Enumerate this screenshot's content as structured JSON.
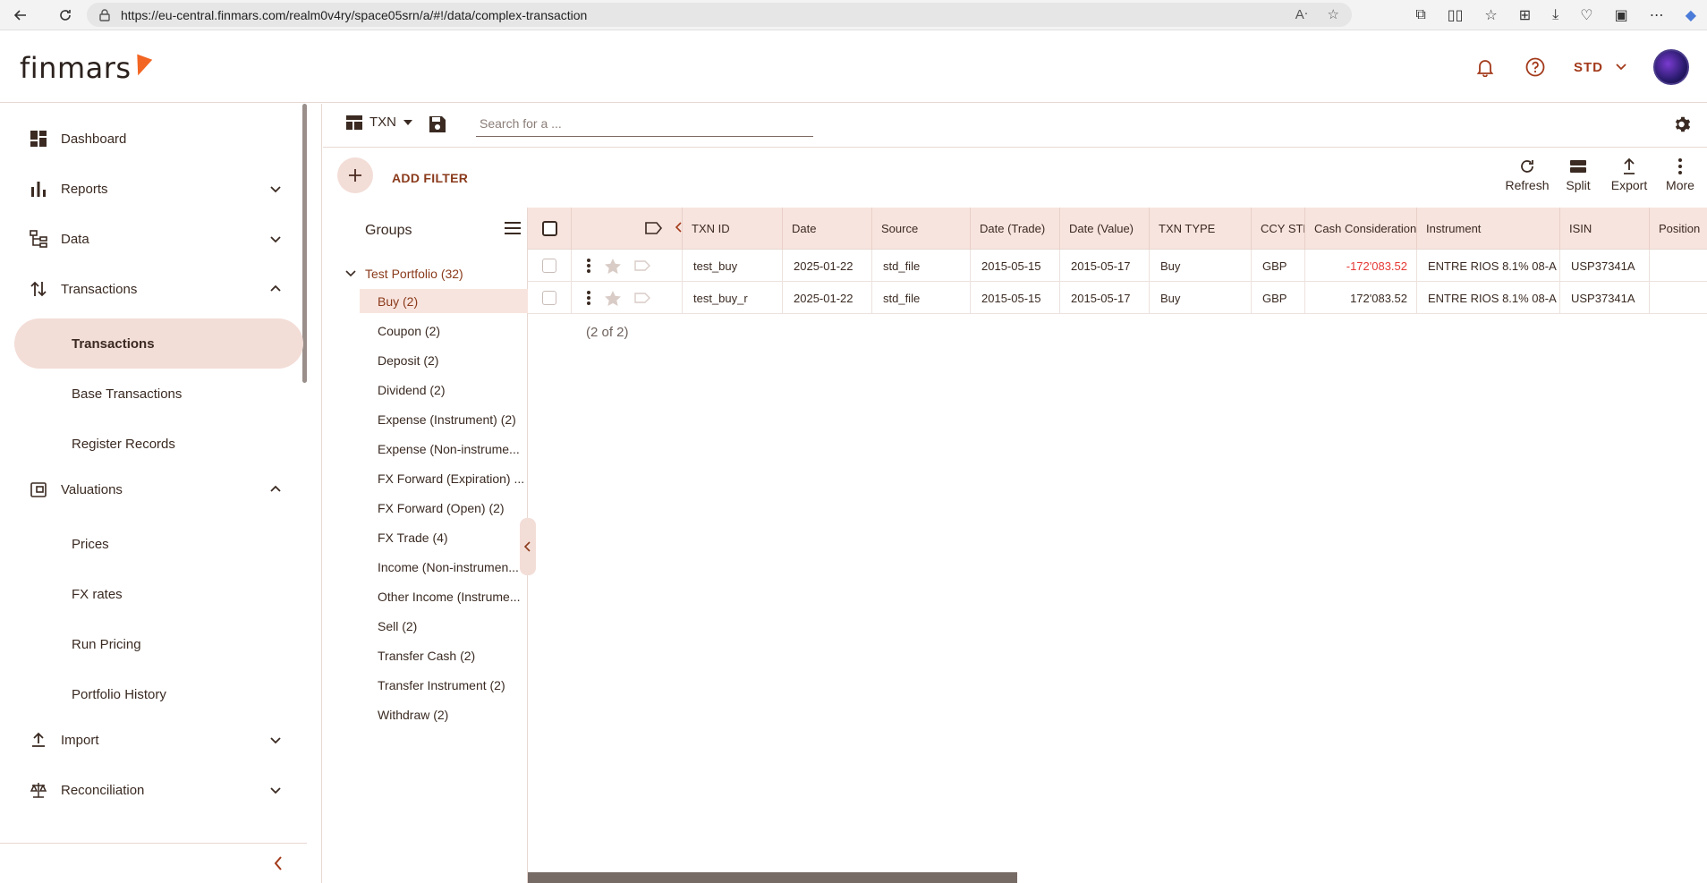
{
  "browser": {
    "url": "https://eu-central.finmars.com/realm0v4ry/space05srn/a/#!/data/complex-transaction"
  },
  "header": {
    "logo": "finmars",
    "user_code": "STD",
    "colors": {
      "accent": "#a33a1b",
      "logo_mark": "#f26522"
    }
  },
  "sidebar": {
    "items": [
      {
        "label": "Dashboard",
        "icon": "dashboard-icon"
      },
      {
        "label": "Reports",
        "icon": "bar-chart-icon",
        "chevron": "down"
      },
      {
        "label": "Data",
        "icon": "data-tree-icon",
        "chevron": "down"
      },
      {
        "label": "Transactions",
        "icon": "transactions-icon",
        "chevron": "up"
      },
      {
        "label": "Valuations",
        "icon": "valuations-icon",
        "chevron": "up"
      },
      {
        "label": "Import",
        "icon": "import-icon",
        "chevron": "down"
      },
      {
        "label": "Reconciliation",
        "icon": "scale-icon",
        "chevron": "down"
      }
    ],
    "transactions_sub": [
      "Transactions",
      "Base Transactions",
      "Register Records"
    ],
    "valuations_sub": [
      "Prices",
      "FX rates",
      "Run Pricing",
      "Portfolio History"
    ]
  },
  "toolbar": {
    "layout_label": "TXN",
    "search_placeholder": "Search for a ...",
    "add_filter_label": "ADD FILTER",
    "actions": [
      "Refresh",
      "Split",
      "Export",
      "More"
    ]
  },
  "groups": {
    "title": "Groups",
    "root": "Test Portfolio (32)",
    "items": [
      "Buy (2)",
      "Coupon (2)",
      "Deposit (2)",
      "Dividend (2)",
      "Expense (Instrument) (2)",
      "Expense (Non-instrume...",
      "FX Forward (Expiration) ...",
      "FX Forward (Open) (2)",
      "FX Trade (4)",
      "Income (Non-instrumen...",
      "Other Income (Instrume...",
      "Sell (2)",
      "Transfer Cash (2)",
      "Transfer Instrument (2)",
      "Withdraw (2)"
    ],
    "selected": "Buy (2)"
  },
  "table": {
    "columns": [
      "TXN ID",
      "Date",
      "Source",
      "Date (Trade)",
      "Date (Value)",
      "TXN TYPE",
      "CCY STL",
      "Cash Consideration",
      "Instrument",
      "ISIN",
      "Position"
    ],
    "rows": [
      [
        "test_buy",
        "2025-01-22",
        "std_file",
        "2015-05-15",
        "2015-05-17",
        "Buy",
        "GBP",
        "-172'083.52",
        "ENTRE RIOS 8.1% 08-A",
        "USP37341A",
        ""
      ],
      [
        "test_buy_r",
        "2025-01-22",
        "std_file",
        "2015-05-15",
        "2015-05-17",
        "Buy",
        "GBP",
        "172'083.52",
        "ENTRE RIOS 8.1% 08-A",
        "USP37341A",
        ""
      ]
    ],
    "count_label": "(2 of 2)"
  }
}
